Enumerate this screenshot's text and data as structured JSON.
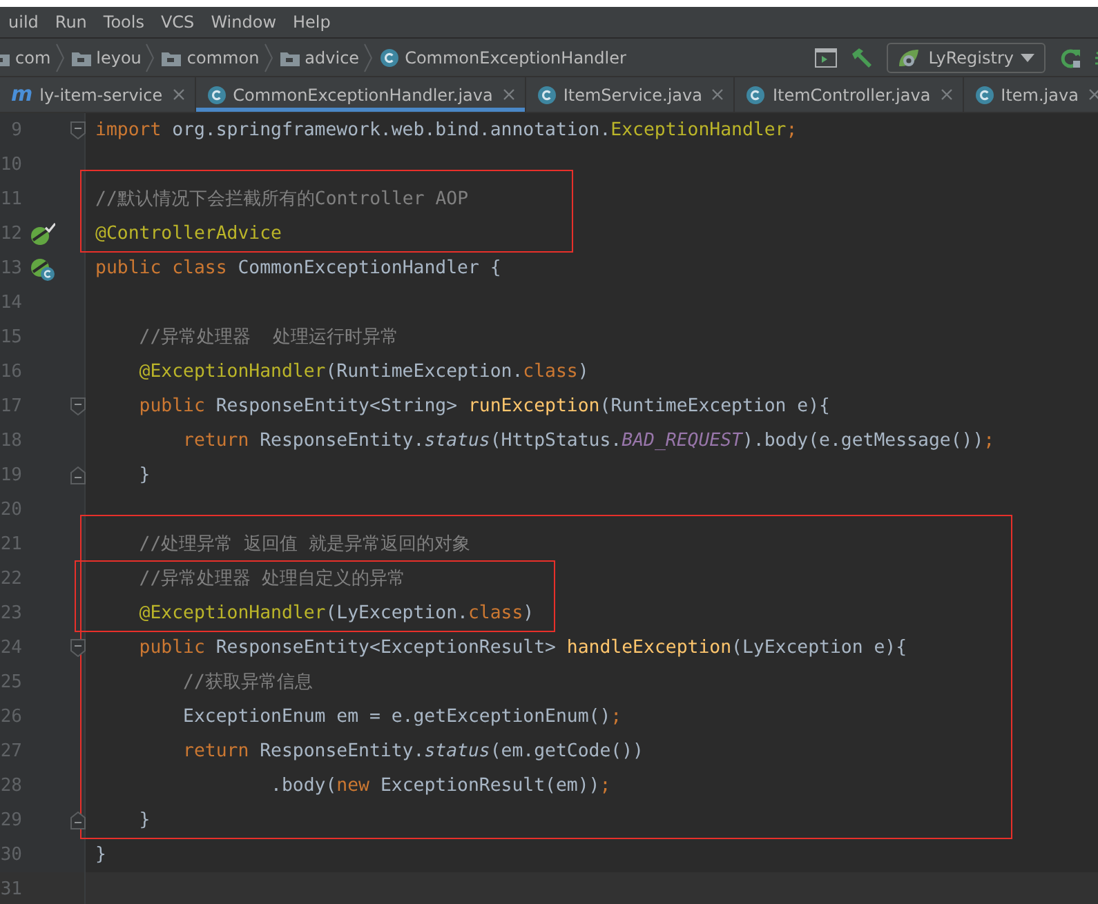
{
  "menu": [
    {
      "label": "uild"
    },
    {
      "label": "Run"
    },
    {
      "label": "Tools"
    },
    {
      "label": "VCS"
    },
    {
      "label": "Window"
    },
    {
      "label": "Help"
    }
  ],
  "breadcrumb": [
    {
      "label": "com",
      "kind": "folder"
    },
    {
      "label": "leyou",
      "kind": "folder"
    },
    {
      "label": "common",
      "kind": "folder"
    },
    {
      "label": "advice",
      "kind": "folder"
    },
    {
      "label": "CommonExceptionHandler",
      "kind": "class"
    }
  ],
  "run_config": {
    "label": "LyRegistry"
  },
  "tabs": [
    {
      "label": "ly-item-service",
      "kind": "module",
      "glyph": "m",
      "selected": false
    },
    {
      "label": "CommonExceptionHandler.java",
      "kind": "class",
      "selected": true
    },
    {
      "label": "ItemService.java",
      "kind": "class",
      "selected": false
    },
    {
      "label": "ItemController.java",
      "kind": "class",
      "selected": false
    },
    {
      "label": "Item.java",
      "kind": "class",
      "selected": false
    }
  ],
  "code": [
    {
      "number": "9",
      "fold": {
        "kind": "start"
      },
      "tokens": [
        {
          "kind": "kw",
          "s": "import"
        },
        {
          "kind": "plain",
          "s": " org.springframework.web.bind.annotation."
        },
        {
          "kind": "ann",
          "s": "ExceptionHandler"
        },
        {
          "kind": "semi",
          "s": ";"
        }
      ]
    },
    {
      "number": "10"
    },
    {
      "kind": "frame",
      "lines": [
        {
          "number": "11",
          "tokens": [
            {
              "kind": "comment",
              "s": "//默认情况下会拦截所有的Controller AOP"
            }
          ]
        },
        {
          "number": "12",
          "gutter": {
            "kind": "advice"
          },
          "tokens": [
            {
              "kind": "ann",
              "s": "@ControllerAdvice"
            }
          ]
        }
      ]
    },
    {
      "number": "13",
      "gutter": {
        "kind": "class"
      },
      "tokens": [
        {
          "kind": "kw",
          "s": "public class"
        },
        {
          "kind": "plain",
          "s": " CommonExceptionHandler {"
        }
      ]
    },
    {
      "number": "14"
    },
    {
      "number": "15",
      "tokens": [
        {
          "kind": "comment",
          "s": "    //异常处理器  处理运行时异常"
        }
      ]
    },
    {
      "number": "16",
      "tokens": [
        {
          "kind": "ann",
          "s": "    @ExceptionHandler"
        },
        {
          "kind": "plain",
          "s": "(RuntimeException."
        },
        {
          "kind": "kw",
          "s": "class"
        },
        {
          "kind": "plain",
          "s": ")"
        }
      ]
    },
    {
      "number": "17",
      "fold": {
        "kind": "start"
      },
      "tokens": [
        {
          "kind": "kw",
          "s": "    public"
        },
        {
          "kind": "plain",
          "s": " ResponseEntity<String> "
        },
        {
          "kind": "method",
          "s": "runException"
        },
        {
          "kind": "plain",
          "s": "(RuntimeException e){"
        }
      ]
    },
    {
      "number": "18",
      "tokens": [
        {
          "kind": "kw",
          "s": "        return"
        },
        {
          "kind": "plain",
          "s": " ResponseEntity."
        },
        {
          "kind": "static",
          "s": "status"
        },
        {
          "kind": "plain",
          "s": "(HttpStatus."
        },
        {
          "kind": "const",
          "s": "BAD_REQUEST"
        },
        {
          "kind": "plain",
          "s": ").body(e.getMessage())"
        },
        {
          "kind": "semi",
          "s": ";"
        }
      ]
    },
    {
      "number": "19",
      "fold": {
        "kind": "end"
      },
      "tokens": [
        {
          "kind": "plain",
          "s": "    }"
        }
      ]
    },
    {
      "number": "20"
    },
    {
      "kind": "frame",
      "lines": [
        {
          "number": "21",
          "tokens": [
            {
              "kind": "comment",
              "s": "    //处理异常 返回值 就是异常返回的对象"
            }
          ]
        },
        {
          "kind": "frame",
          "lines": [
            {
              "number": "22",
              "tokens": [
                {
                  "kind": "comment",
                  "s": "    //异常处理器 处理自定义的异常"
                }
              ]
            },
            {
              "number": "23",
              "tokens": [
                {
                  "kind": "ann",
                  "s": "    @ExceptionHandler"
                },
                {
                  "kind": "plain",
                  "s": "(LyException."
                },
                {
                  "kind": "kw",
                  "s": "class"
                },
                {
                  "kind": "plain",
                  "s": ")"
                }
              ]
            }
          ]
        },
        {
          "number": "24",
          "fold": {
            "kind": "start"
          },
          "tokens": [
            {
              "kind": "kw",
              "s": "    public"
            },
            {
              "kind": "plain",
              "s": " ResponseEntity<ExceptionResult> "
            },
            {
              "kind": "method",
              "s": "handleException"
            },
            {
              "kind": "plain",
              "s": "(LyException e){"
            }
          ]
        },
        {
          "number": "25",
          "tokens": [
            {
              "kind": "comment",
              "s": "        //获取异常信息"
            }
          ]
        },
        {
          "number": "26",
          "tokens": [
            {
              "kind": "plain",
              "s": "        ExceptionEnum em = e.getExceptionEnum()"
            },
            {
              "kind": "semi",
              "s": ";"
            }
          ]
        },
        {
          "number": "27",
          "tokens": [
            {
              "kind": "kw",
              "s": "        return"
            },
            {
              "kind": "plain",
              "s": " ResponseEntity."
            },
            {
              "kind": "static",
              "s": "status"
            },
            {
              "kind": "plain",
              "s": "(em.getCode())"
            }
          ]
        },
        {
          "number": "28",
          "tokens": [
            {
              "kind": "plain",
              "s": "                .body("
            },
            {
              "kind": "kw",
              "s": "new"
            },
            {
              "kind": "plain",
              "s": " ExceptionResult(em))"
            },
            {
              "kind": "semi",
              "s": ";"
            }
          ]
        },
        {
          "number": "29",
          "fold": {
            "kind": "end"
          },
          "tokens": [
            {
              "kind": "plain",
              "s": "    }"
            }
          ]
        }
      ]
    },
    {
      "number": "30",
      "tokens": [
        {
          "kind": "plain",
          "s": "}"
        }
      ]
    },
    {
      "number": "31",
      "current": true
    }
  ]
}
